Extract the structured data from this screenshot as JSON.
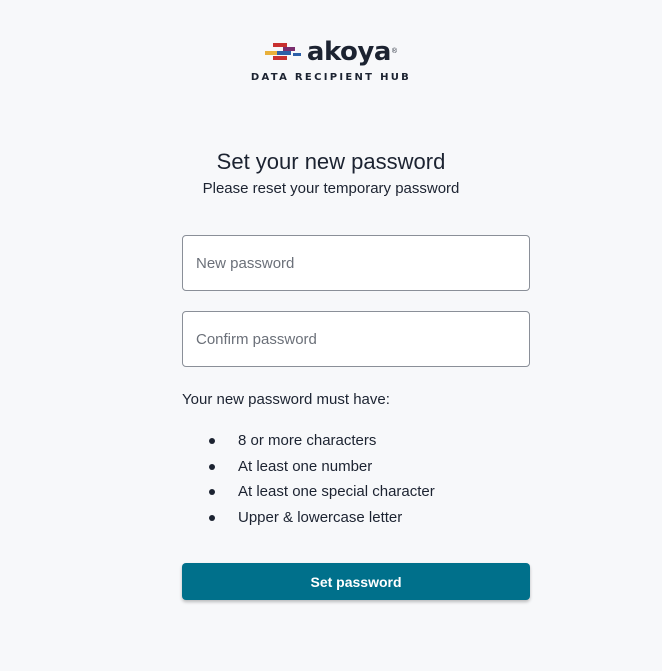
{
  "brand": {
    "name": "akoya",
    "registered_mark": "®",
    "tagline": "DATA RECIPIENT HUB",
    "logo_colors": [
      "#e8b03a",
      "#2c5fa8",
      "#c8302f",
      "#7a2e6e"
    ]
  },
  "heading": {
    "title": "Set your new password",
    "subtitle": "Please reset your temporary password"
  },
  "form": {
    "new_password": {
      "placeholder": "New password",
      "value": ""
    },
    "confirm_password": {
      "placeholder": "Confirm password",
      "value": ""
    },
    "rules_label": "Your new password must have:",
    "rules": [
      "8 or more characters",
      "At least one number",
      "At least one special character",
      "Upper & lowercase letter"
    ],
    "submit_label": "Set password"
  },
  "colors": {
    "background": "#f7f8fa",
    "primary_button": "#00708b",
    "text": "#1c2331"
  }
}
